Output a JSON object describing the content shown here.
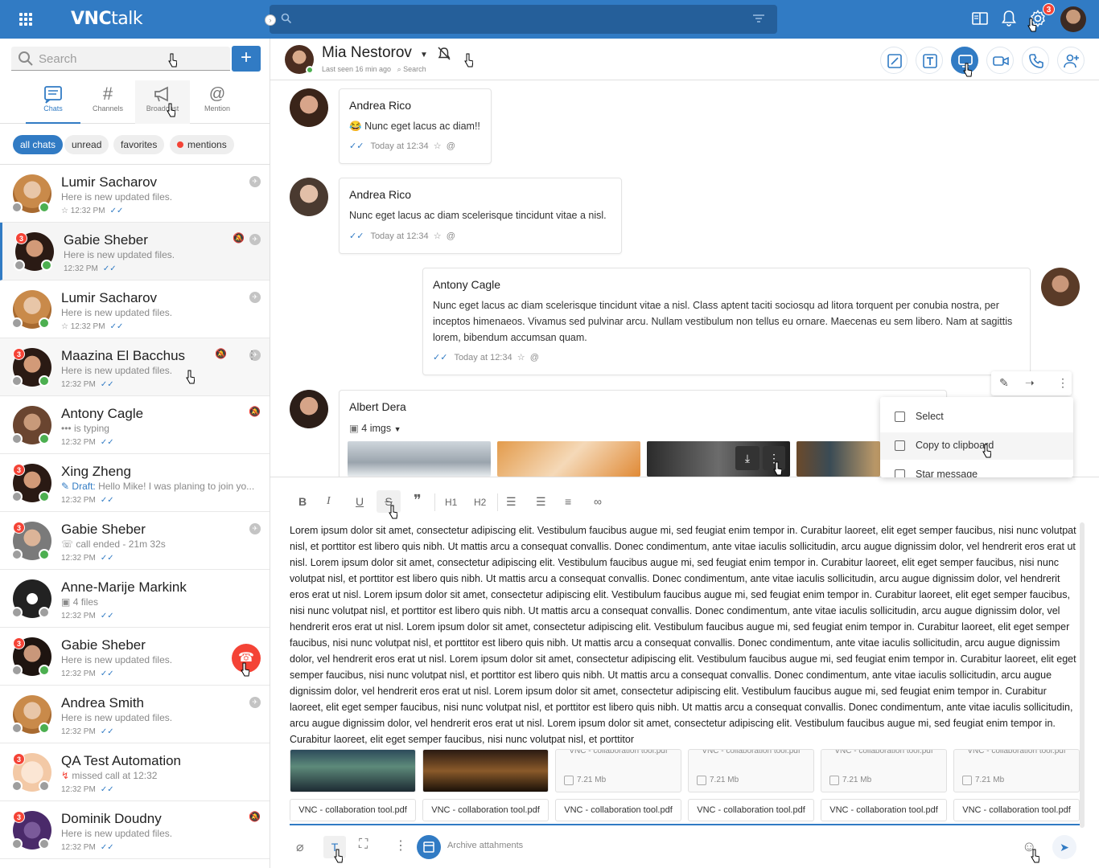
{
  "app": {
    "logo_vnc": "VNC",
    "logo_talk": "talk",
    "notif_count": "3"
  },
  "sidebar": {
    "search_placeholder": "Search",
    "tabs": [
      {
        "label": "Chats"
      },
      {
        "label": "Channels"
      },
      {
        "label": "Broadcast"
      },
      {
        "label": "Mention"
      }
    ],
    "filters": [
      {
        "label": "all chats"
      },
      {
        "label": "unread"
      },
      {
        "label": "favorites"
      },
      {
        "label": "mentions"
      }
    ],
    "chats": [
      {
        "name": "Lumir Sacharov",
        "sub": "Here is new updated files.",
        "time": "12:32 PM",
        "badge": ""
      },
      {
        "name": "Gabie Sheber",
        "sub": "Here is new updated files.",
        "time": "12:32 PM",
        "badge": "3"
      },
      {
        "name": "Lumir Sacharov",
        "sub": "Here is new updated files.",
        "time": "12:32 PM",
        "badge": ""
      },
      {
        "name": "Maazina El Bacchus",
        "sub": "Here is new updated files.",
        "time": "12:32 PM",
        "badge": "3"
      },
      {
        "name": "Antony Cagle",
        "sub": "is typing",
        "time": "12:32 PM",
        "badge": ""
      },
      {
        "name": "Xing Zheng",
        "sub_prefix": "Draft:",
        "sub": "Hello Mike! I was planing to join yo...",
        "time": "12:32 PM",
        "badge": "3"
      },
      {
        "name": "Gabie Sheber",
        "sub": "call ended - 21m 32s",
        "time": "12:32 PM",
        "badge": "3"
      },
      {
        "name": "Anne-Marije Markink",
        "sub": "4 files",
        "time": "12:32 PM",
        "badge": ""
      },
      {
        "name": "Gabie Sheber",
        "sub": "Here is new updated files.",
        "time": "12:32 PM",
        "badge": "3"
      },
      {
        "name": "Andrea Smith",
        "sub": "Here is new updated files.",
        "time": "12:32 PM",
        "badge": ""
      },
      {
        "name": "QA Test Automation",
        "sub": "missed call at 12:32",
        "time": "12:32 PM",
        "badge": "3"
      },
      {
        "name": "Dominik Doudny",
        "sub": "Here is new updated files.",
        "time": "12:32 PM",
        "badge": "3"
      }
    ]
  },
  "header": {
    "name": "Mia Nestorov",
    "last_seen": "Last seen 16 min ago",
    "search_label": "Search"
  },
  "messages": [
    {
      "author": "Andrea Rico",
      "emoji": "😂",
      "text": "Nunc eget lacus ac diam!!",
      "time": "Today at 12:34"
    },
    {
      "author": "Andrea Rico",
      "text": "Nunc eget lacus ac diam scelerisque tincidunt vitae a nisl.",
      "time": "Today at 12:34"
    },
    {
      "author": "Antony Cagle",
      "text": "Nunc eget lacus ac diam scelerisque tincidunt vitae a nisl. Class aptent taciti sociosqu ad litora torquent per conubia nostra, per inceptos himenaeos. Vivamus sed pulvinar arcu. Nullam vestibulum non tellus eu ornare. Maecenas eu sem libero. Nam at sagittis lorem, bibendum accumsan quam.",
      "time": "Today at 12:34"
    },
    {
      "author": "Albert Dera",
      "imgs_label": "4 imgs"
    }
  ],
  "context_menu": {
    "items": [
      {
        "label": "Select"
      },
      {
        "label": "Copy to clipboard"
      },
      {
        "label": "Star message"
      }
    ]
  },
  "editor": {
    "text": "Lorem ipsum dolor sit amet, consectetur adipiscing elit. Vestibulum faucibus augue mi, sed feugiat enim tempor in. Curabitur laoreet, elit eget semper faucibus, nisi nunc volutpat nisl, et porttitor est libero quis nibh. Ut mattis arcu a consequat convallis. Donec condimentum, ante vitae iaculis sollicitudin, arcu augue dignissim dolor, vel hendrerit eros erat ut nisl. Lorem ipsum dolor sit amet, consectetur adipiscing elit. Vestibulum faucibus augue mi, sed feugiat enim tempor in. Curabitur laoreet, elit eget semper faucibus, nisi nunc volutpat nisl, et porttitor est libero quis nibh. Ut mattis arcu a consequat convallis. Donec condimentum, ante vitae iaculis sollicitudin, arcu augue dignissim dolor, vel hendrerit eros erat ut nisl.  Lorem ipsum dolor sit amet, consectetur adipiscing elit. Vestibulum faucibus augue mi, sed feugiat enim tempor in. Curabitur laoreet, elit eget semper faucibus, nisi nunc volutpat nisl, et porttitor est libero quis nibh. Ut mattis arcu a consequat convallis. Donec condimentum, ante vitae iaculis sollicitudin, arcu augue dignissim dolor, vel hendrerit eros erat ut nisl.  Lorem ipsum dolor sit amet, consectetur adipiscing elit. Vestibulum faucibus augue mi, sed feugiat enim tempor in. Curabitur laoreet, elit eget semper faucibus, nisi nunc volutpat nisl, et porttitor est libero quis nibh. Ut mattis arcu a consequat convallis. Donec condimentum, ante vitae iaculis sollicitudin, arcu augue dignissim dolor, vel hendrerit eros erat ut nisl.  Lorem ipsum dolor sit amet, consectetur adipiscing elit. Vestibulum faucibus augue mi, sed feugiat enim tempor in. Curabitur laoreet, elit eget semper faucibus, nisi nunc volutpat nisl, et porttitor est libero quis nibh. Ut mattis arcu a consequat convallis. Donec condimentum, ante vitae iaculis sollicitudin, arcu augue dignissim dolor, vel hendrerit eros erat ut nisl.  Lorem ipsum dolor sit amet, consectetur adipiscing elit. Vestibulum faucibus augue mi, sed feugiat enim tempor in. Curabitur laoreet, elit eget semper faucibus, nisi nunc volutpat nisl, et porttitor est libero quis nibh. Ut mattis arcu a consequat convallis. Donec condimentum, ante vitae iaculis sollicitudin, arcu augue dignissim dolor, vel hendrerit eros erat ut nisl.  Lorem ipsum dolor sit amet, consectetur adipiscing elit. Vestibulum faucibus augue mi, sed feugiat enim tempor in. Curabitur laoreet, elit eget semper faucibus, nisi nunc volutpat nisl, et porttitor",
    "attachments": [
      {
        "name": "",
        "size": ""
      },
      {
        "name": "",
        "size": ""
      },
      {
        "name": "VNC - collaboration tool.pdf",
        "size": "7.21 Mb"
      },
      {
        "name": "VNC - collaboration tool.pdf",
        "size": "7.21 Mb"
      },
      {
        "name": "VNC - collaboration tool.pdf",
        "size": "7.21 Mb"
      },
      {
        "name": "VNC - collaboration tool.pdf",
        "size": "7.21 Mb"
      }
    ],
    "file_names": [
      "VNC - collaboration tool.pdf",
      "VNC - collaboration tool.pdf",
      "VNC - collaboration tool.pdf",
      "VNC - collaboration tool.pdf",
      "VNC - collaboration tool.pdf",
      "VNC - collaboration tool.pdf"
    ],
    "archive_label": "Archive attahments"
  }
}
